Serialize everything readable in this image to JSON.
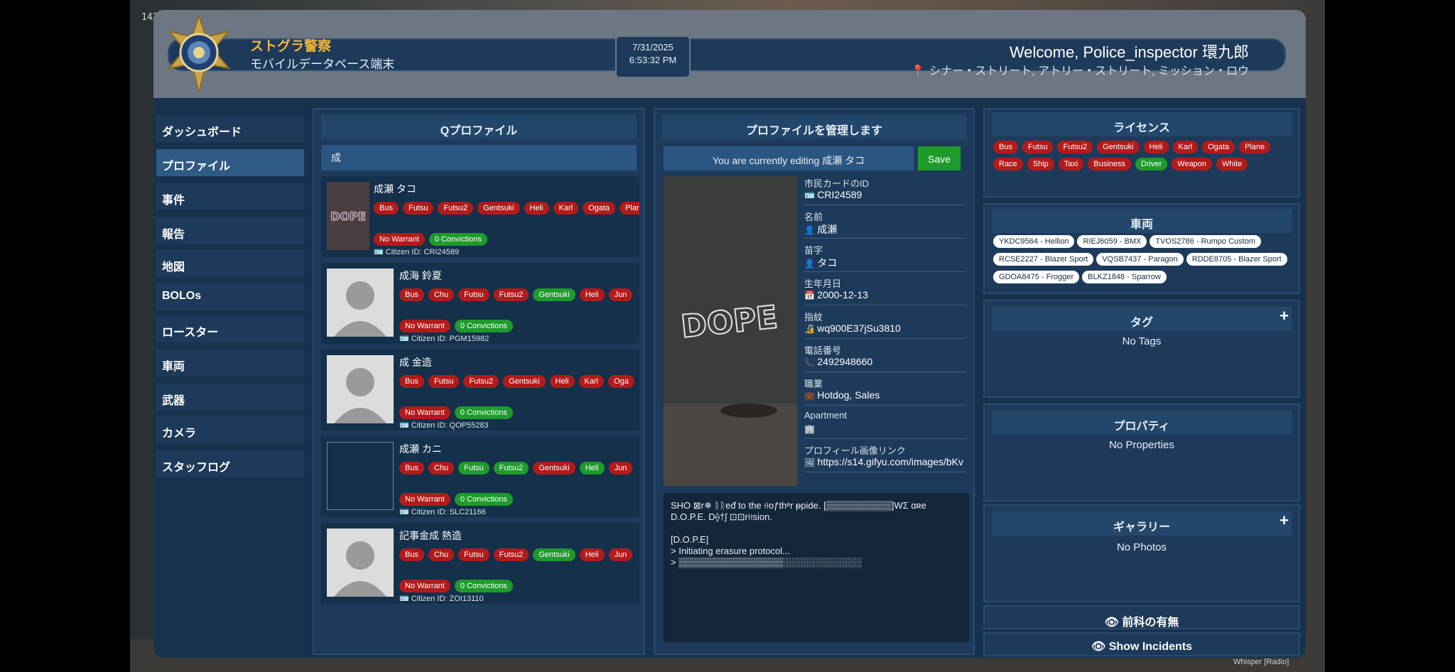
{
  "overlay": {
    "fps": "142fps",
    "whisper": "Whisper [Radio]"
  },
  "header": {
    "org_name": "ストグラ警察",
    "org_subtitle": "モバイルデータベース端末",
    "date": "7/31/2025",
    "time": "6:53:32 PM",
    "welcome": "Welcome, Police_inspector 環九郎",
    "location": "シナー・ストリート, アトリー・ストリート, ミッション・ロウ"
  },
  "sidebar": {
    "items": [
      {
        "label": "ダッシュボード"
      },
      {
        "label": "プロファイル"
      },
      {
        "label": "事件"
      },
      {
        "label": "報告"
      },
      {
        "label": "地図"
      },
      {
        "label": "BOLOs"
      },
      {
        "label": "ロースター"
      },
      {
        "label": "車両"
      },
      {
        "label": "武器"
      },
      {
        "label": "カメラ"
      },
      {
        "label": "スタッフログ"
      }
    ],
    "active": "プロファイル"
  },
  "profiles_panel": {
    "title": "Qプロファイル",
    "search_value": "成",
    "results": [
      {
        "name": "成瀬 タコ",
        "licenses": [
          "Bus",
          "Futsu",
          "Futsu2",
          "Gentsuki",
          "Heli",
          "Karl",
          "Ogata",
          "Plane"
        ],
        "green": [],
        "warrant": "No Warrant",
        "convictions": "0 Convictions",
        "citizen_id": "Citizen ID: CRI24589"
      },
      {
        "name": "成海 鈴夏",
        "licenses": [
          "Bus",
          "Chu",
          "Futsu",
          "Futsu2",
          "Gentsuki",
          "Heli",
          "Jun"
        ],
        "green": [
          "Gentsuki"
        ],
        "warrant": "No Warrant",
        "convictions": "0 Convictions",
        "citizen_id": "Citizen ID: PGM15982"
      },
      {
        "name": "成 金造",
        "licenses": [
          "Bus",
          "Futsu",
          "Futsu2",
          "Gentsuki",
          "Heli",
          "Karl",
          "Oga"
        ],
        "green": [],
        "warrant": "No Warrant",
        "convictions": "0 Convictions",
        "citizen_id": "Citizen ID: QOP55283"
      },
      {
        "name": "成瀬 カニ",
        "licenses": [
          "Bus",
          "Chu",
          "Futsu",
          "Futsu2",
          "Gentsuki",
          "Heli",
          "Jun"
        ],
        "green": [
          "Futsu",
          "Futsu2",
          "Heli"
        ],
        "warrant": "No Warrant",
        "convictions": "0 Convictions",
        "citizen_id": "Citizen ID: SLC21166"
      },
      {
        "name": "記事金成 熱造",
        "licenses": [
          "Bus",
          "Chu",
          "Futsu",
          "Futsu2",
          "Gentsuki",
          "Heli",
          "Jun"
        ],
        "green": [
          "Gentsuki"
        ],
        "warrant": "No Warrant",
        "convictions": "0 Convictions",
        "citizen_id": "Citizen ID: ZOI13110"
      }
    ]
  },
  "manage_panel": {
    "title": "プロファイルを管理します",
    "editing": "You are currently editing 成瀬 タコ",
    "save_label": "Save",
    "photo_text": "DOPE",
    "fields": [
      {
        "label": "市民カードのID",
        "value": "CRI24589"
      },
      {
        "label": "名前",
        "value": "成瀬"
      },
      {
        "label": "苗字",
        "value": "タコ"
      },
      {
        "label": "生年月日",
        "value": "2000-12-13"
      },
      {
        "label": "指紋",
        "value": "wq900E37jSu3810"
      },
      {
        "label": "電話番号",
        "value": "2492948660"
      },
      {
        "label": "職業",
        "value": "Hotdog, Sales"
      },
      {
        "label": "Apartment",
        "value": ""
      },
      {
        "label": "プロフィール画像リンク",
        "value": "https://s14.gifyu.com/images/bKv"
      }
    ],
    "notes": "SHO ⊠r✵ ᚱᚱeᵭ to the ⟊⟊oƒthᵉr ᵽpide. [▒▒▒▒▒▒▒▒▒▒]WΣ ɑʀe\nD.O.P.E. D⟠†ʃ ⊡⊡r⟊⟊sion.\n\n[D.O.P.E]\n> Initiating erasure protocol...\n> ▒▒▒▒▒▒▒▒▒▒▒▒▒▒▒▒░░░░░░░░░░░░"
  },
  "licenses_panel": {
    "title": "ライセンス",
    "items": [
      {
        "label": "Bus",
        "active": false
      },
      {
        "label": "Futsu",
        "active": false
      },
      {
        "label": "Futsu2",
        "active": false
      },
      {
        "label": "Gentsuki",
        "active": false
      },
      {
        "label": "Heli",
        "active": false
      },
      {
        "label": "Karl",
        "active": false
      },
      {
        "label": "Ogata",
        "active": false
      },
      {
        "label": "Plane",
        "active": false
      },
      {
        "label": "Race",
        "active": false
      },
      {
        "label": "Ship",
        "active": false
      },
      {
        "label": "Taxi",
        "active": false
      },
      {
        "label": "Business",
        "active": false
      },
      {
        "label": "Driver",
        "active": true
      },
      {
        "label": "Weapon",
        "active": false
      },
      {
        "label": "White",
        "active": false
      }
    ]
  },
  "vehicles_panel": {
    "title": "車両",
    "items": [
      "YKDC9564 - Hellion",
      "RIEJ6059 - BMX",
      "TVOS2786 - Rumpo Custom",
      "RCSE2227 - Blazer Sport",
      "VQSB7437 - Paragon",
      "RDDE8705 - Blazer Sport",
      "GDOA8475 - Frogger",
      "BLKZ1848 - Sparrow"
    ]
  },
  "tags_panel": {
    "title": "タグ",
    "empty": "No Tags"
  },
  "properties_panel": {
    "title": "プロパティ",
    "empty": "No Properties"
  },
  "gallery_panel": {
    "title": "ギャラリー",
    "empty": "No Photos"
  },
  "footer": {
    "criminal_record": "前科の有無",
    "show_incidents": "Show Incidents"
  },
  "colors": {
    "accent_gold": "#f0b53a",
    "license_red": "#b21b1b",
    "license_green": "#1f9a2c",
    "panel": "#1e3a5a"
  },
  "icons": [
    "search-icon",
    "id-card-icon",
    "user-icon",
    "calendar-icon",
    "fingerprint-icon",
    "phone-icon",
    "briefcase-icon",
    "building-icon",
    "image-icon",
    "eye-icon",
    "pin-icon",
    "plus-icon",
    "badge-icon"
  ]
}
